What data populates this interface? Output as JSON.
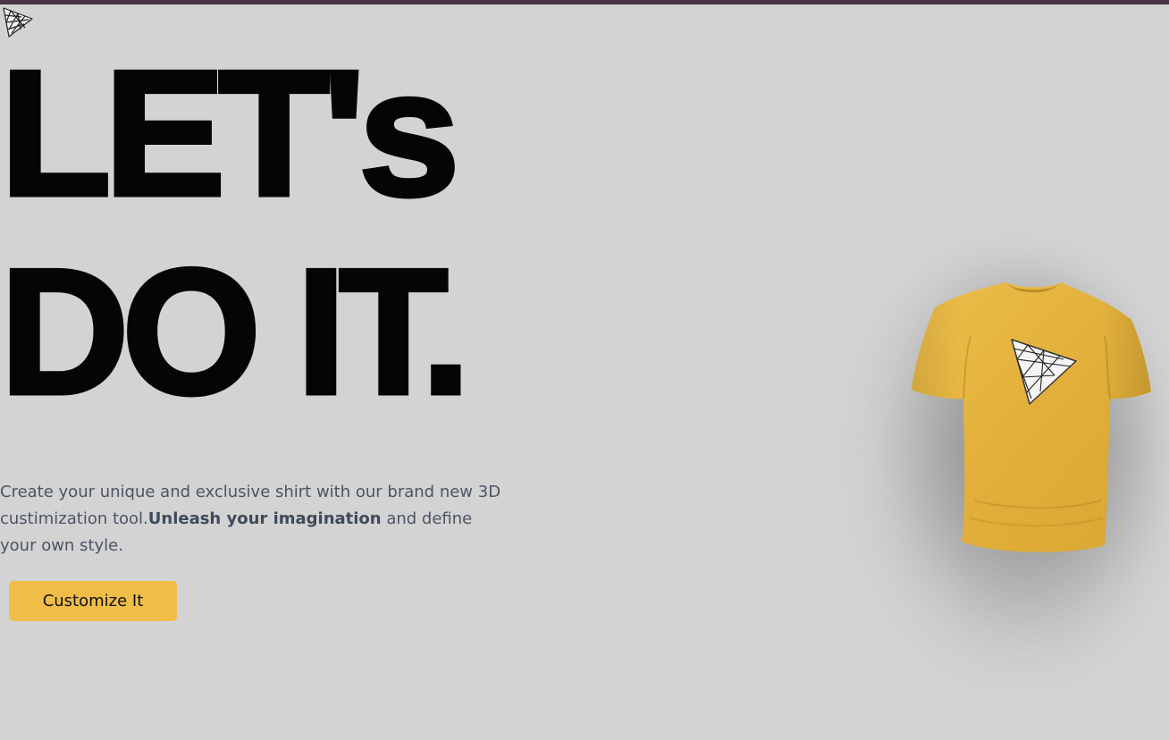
{
  "header": {
    "logo_icon": "threejs-triangle-logo-icon",
    "bar_color": "#4a3344"
  },
  "hero": {
    "headline_line1": "LET's",
    "headline_line2": "DO IT.",
    "description_intro": "Create your unique and exclusive shirt with our brand new 3D custimization tool.",
    "description_bold": "Unleash your imagination",
    "description_outro": " and define your own style.",
    "cta_label": "Customize It"
  },
  "shirt": {
    "color": "#e6b53d",
    "decal_icon": "threejs-triangle-logo-icon"
  },
  "theme": {
    "background": "#d3d3d3",
    "accent": "#efbd48"
  }
}
